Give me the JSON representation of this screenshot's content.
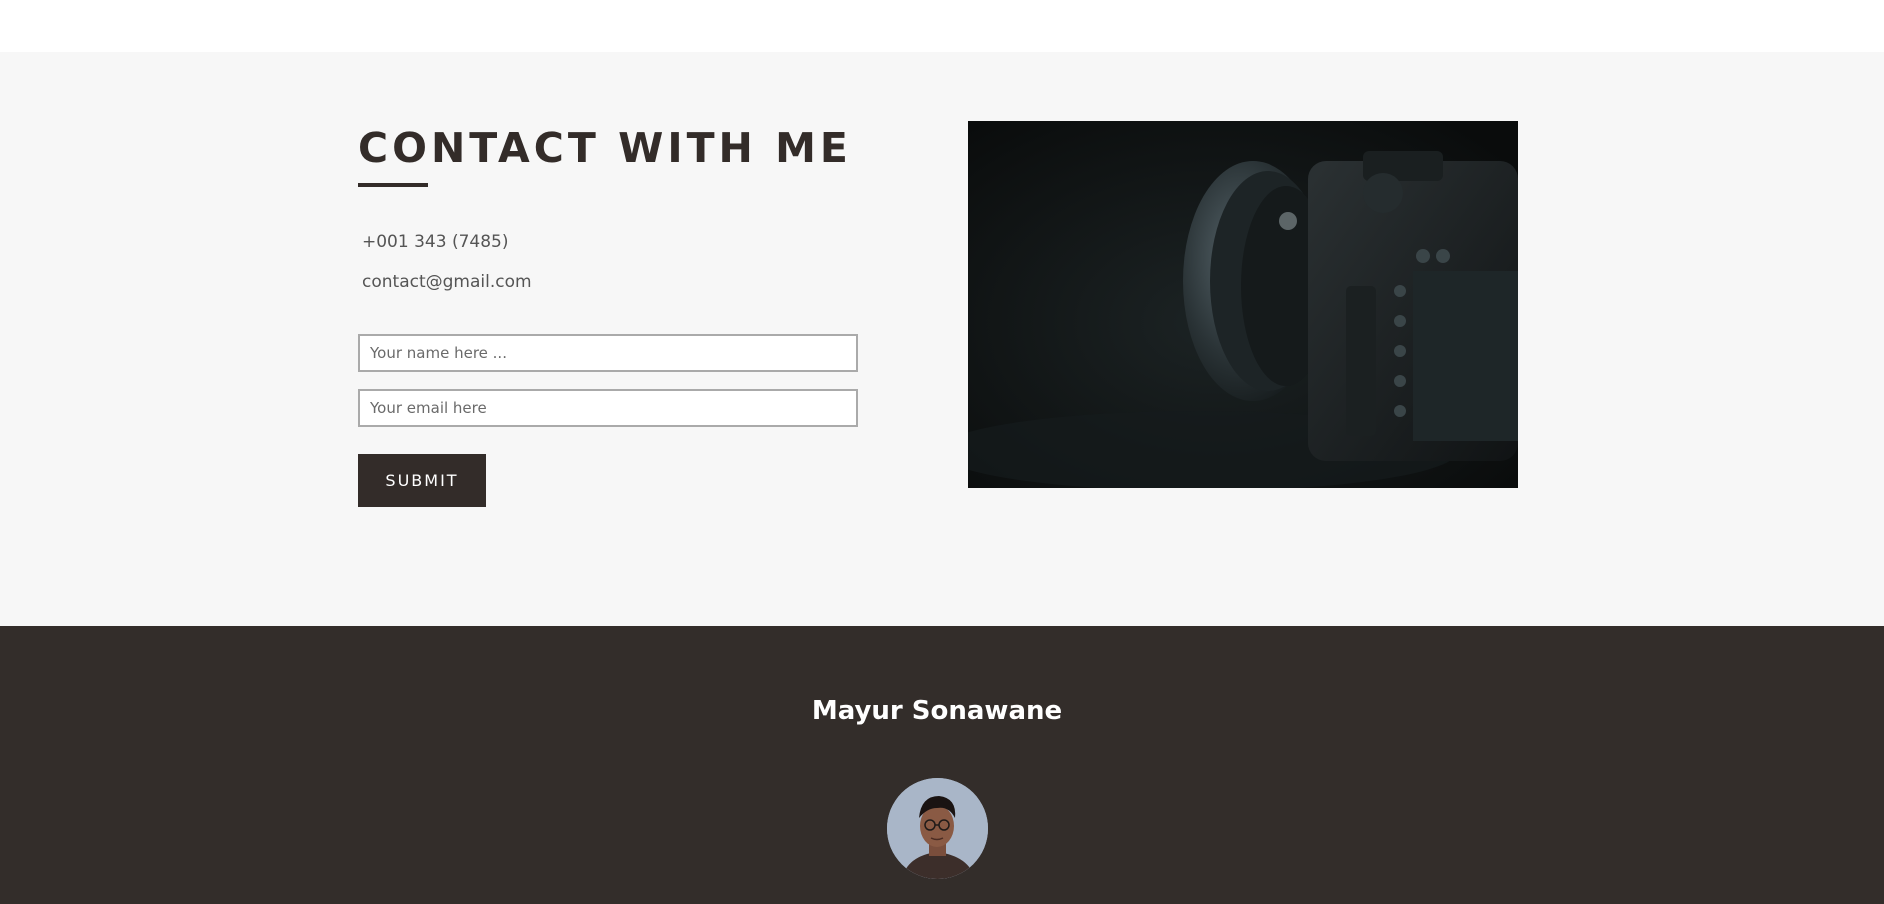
{
  "contact": {
    "title": "CONTACT WITH ME",
    "phone": "+001 343 (7485)",
    "email": "contact@gmail.com",
    "form": {
      "name_placeholder": "Your name here ...",
      "email_placeholder": "Your email here",
      "submit_label": "SUBMIT"
    }
  },
  "footer": {
    "name": "Mayur Sonawane"
  },
  "colors": {
    "accent_dark": "#332c29",
    "section_bg": "#f7f7f7",
    "footer_bg": "#332d2a"
  }
}
